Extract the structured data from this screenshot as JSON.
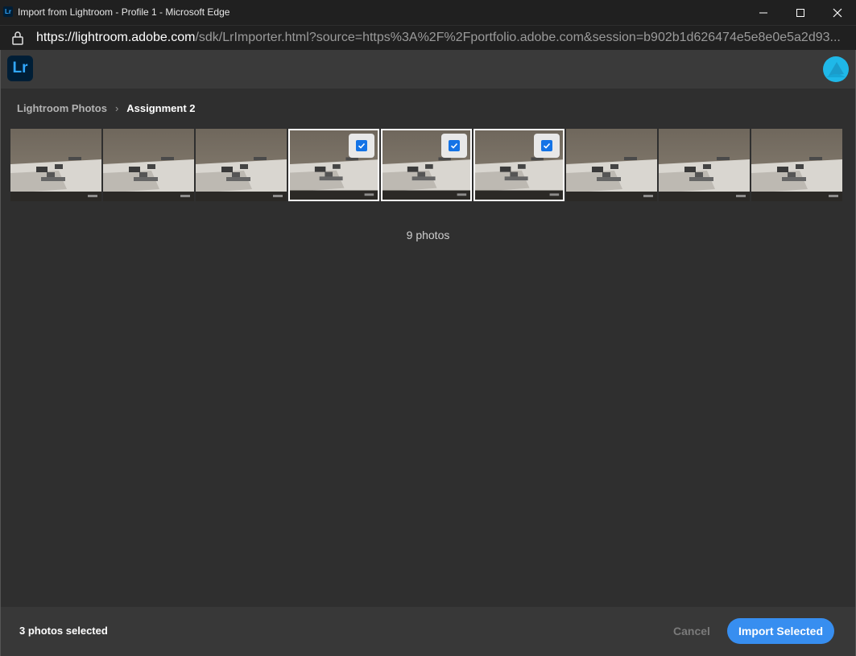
{
  "window": {
    "title": "Import from Lightroom - Profile 1 - Microsoft Edge",
    "app_icon_text": "Lr"
  },
  "address": {
    "host": "https://lightroom.adobe.com",
    "path": "/sdk/LrImporter.html?source=https%3A%2F%2Fportfolio.adobe.com&session=b902b1d626474e5e8e0e5a2d93..."
  },
  "header": {
    "logo_text": "Lr"
  },
  "breadcrumb": {
    "root": "Lightroom Photos",
    "separator": "›",
    "current": "Assignment 2"
  },
  "photos": [
    {
      "selected": false
    },
    {
      "selected": false
    },
    {
      "selected": false
    },
    {
      "selected": true
    },
    {
      "selected": true
    },
    {
      "selected": true
    },
    {
      "selected": false
    },
    {
      "selected": false
    },
    {
      "selected": false
    }
  ],
  "photo_count_text": "9 photos",
  "footer": {
    "selected_text": "3 photos selected",
    "cancel_label": "Cancel",
    "import_label": "Import Selected"
  },
  "colors": {
    "accent": "#378ef0",
    "logo_bg": "#001e36",
    "logo_fg": "#31a8ff",
    "avatar": "#1fb8e8"
  }
}
